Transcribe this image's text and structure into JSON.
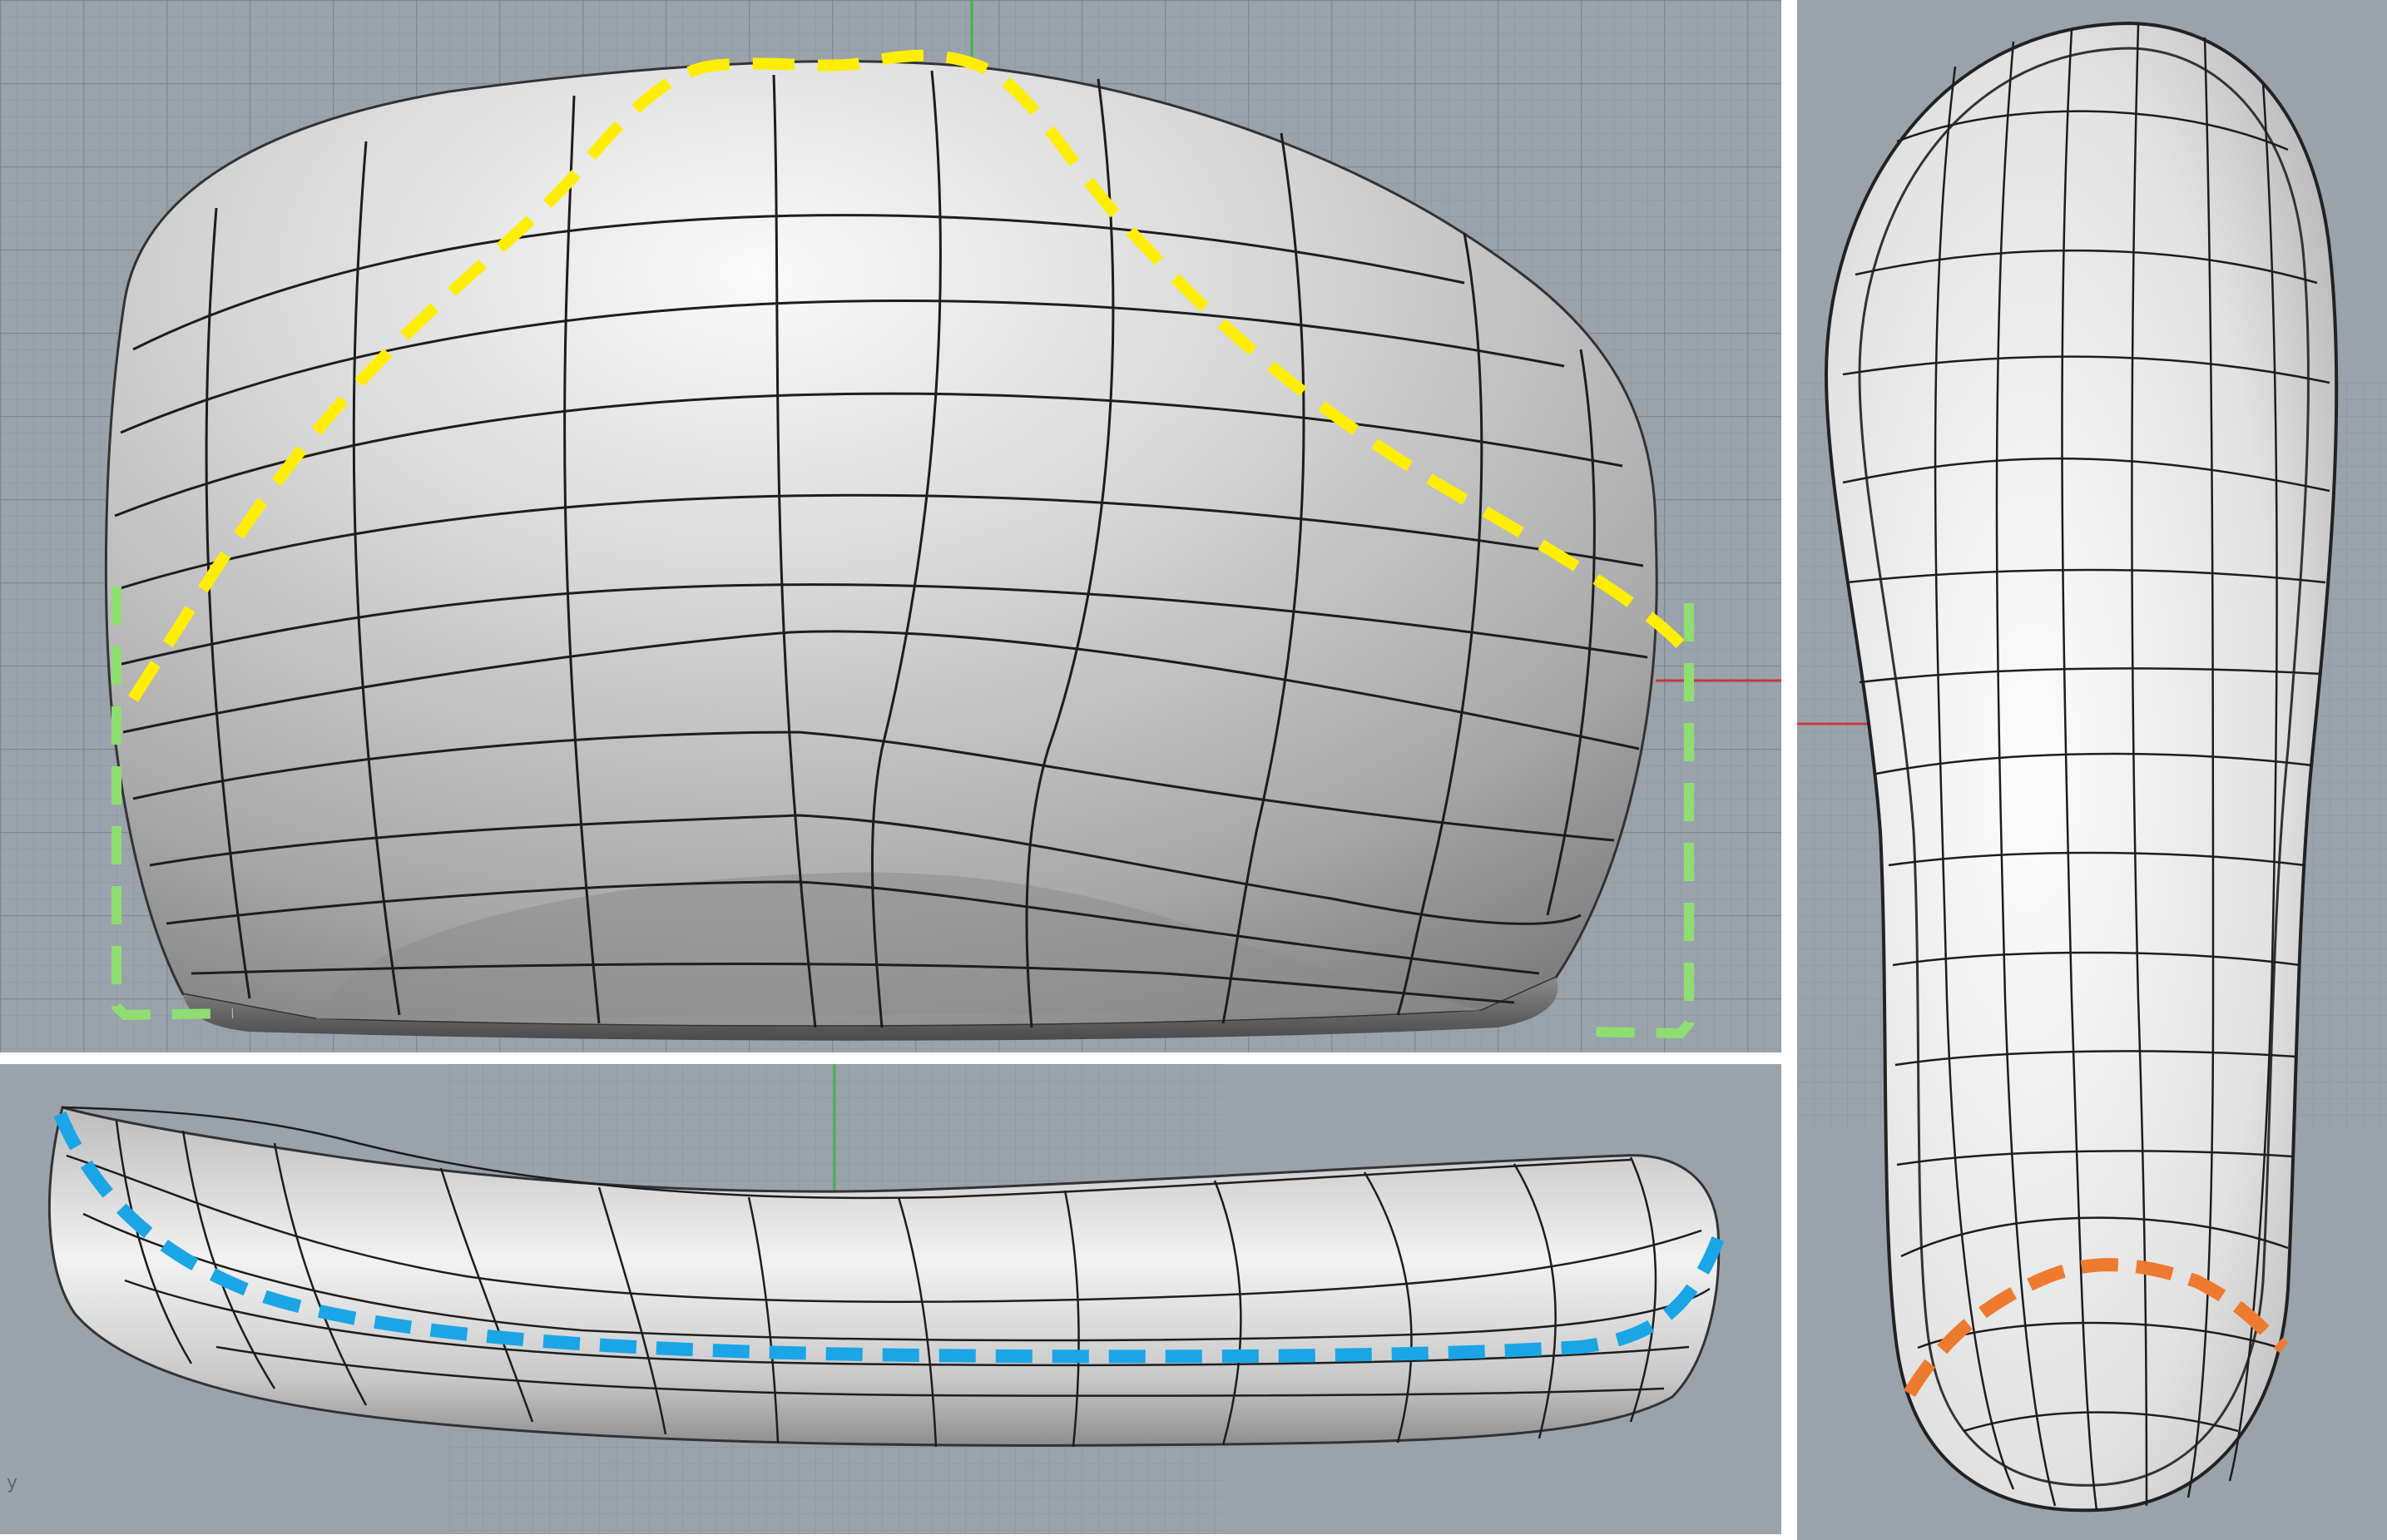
{
  "viewports": {
    "front": {
      "view": "front",
      "overlay_colors": {
        "top_profile": "#ffee00",
        "side_walls": "#8ede72"
      }
    },
    "side": {
      "view": "side",
      "axis_label": "y",
      "overlay_colors": {
        "arch_profile": "#1aa6e6"
      }
    },
    "bottom": {
      "view": "bottom",
      "overlay_colors": {
        "heel_curve": "#ee7a2f"
      }
    }
  },
  "theme": {
    "background": "#9aa3ac",
    "grid_minor": "#8f98a2",
    "grid_major": "#7f8893",
    "axis_x": "#c43b3b",
    "axis_y": "#3fb64a",
    "surface": "#d6d6d6",
    "wire": "#1d1d1d"
  }
}
